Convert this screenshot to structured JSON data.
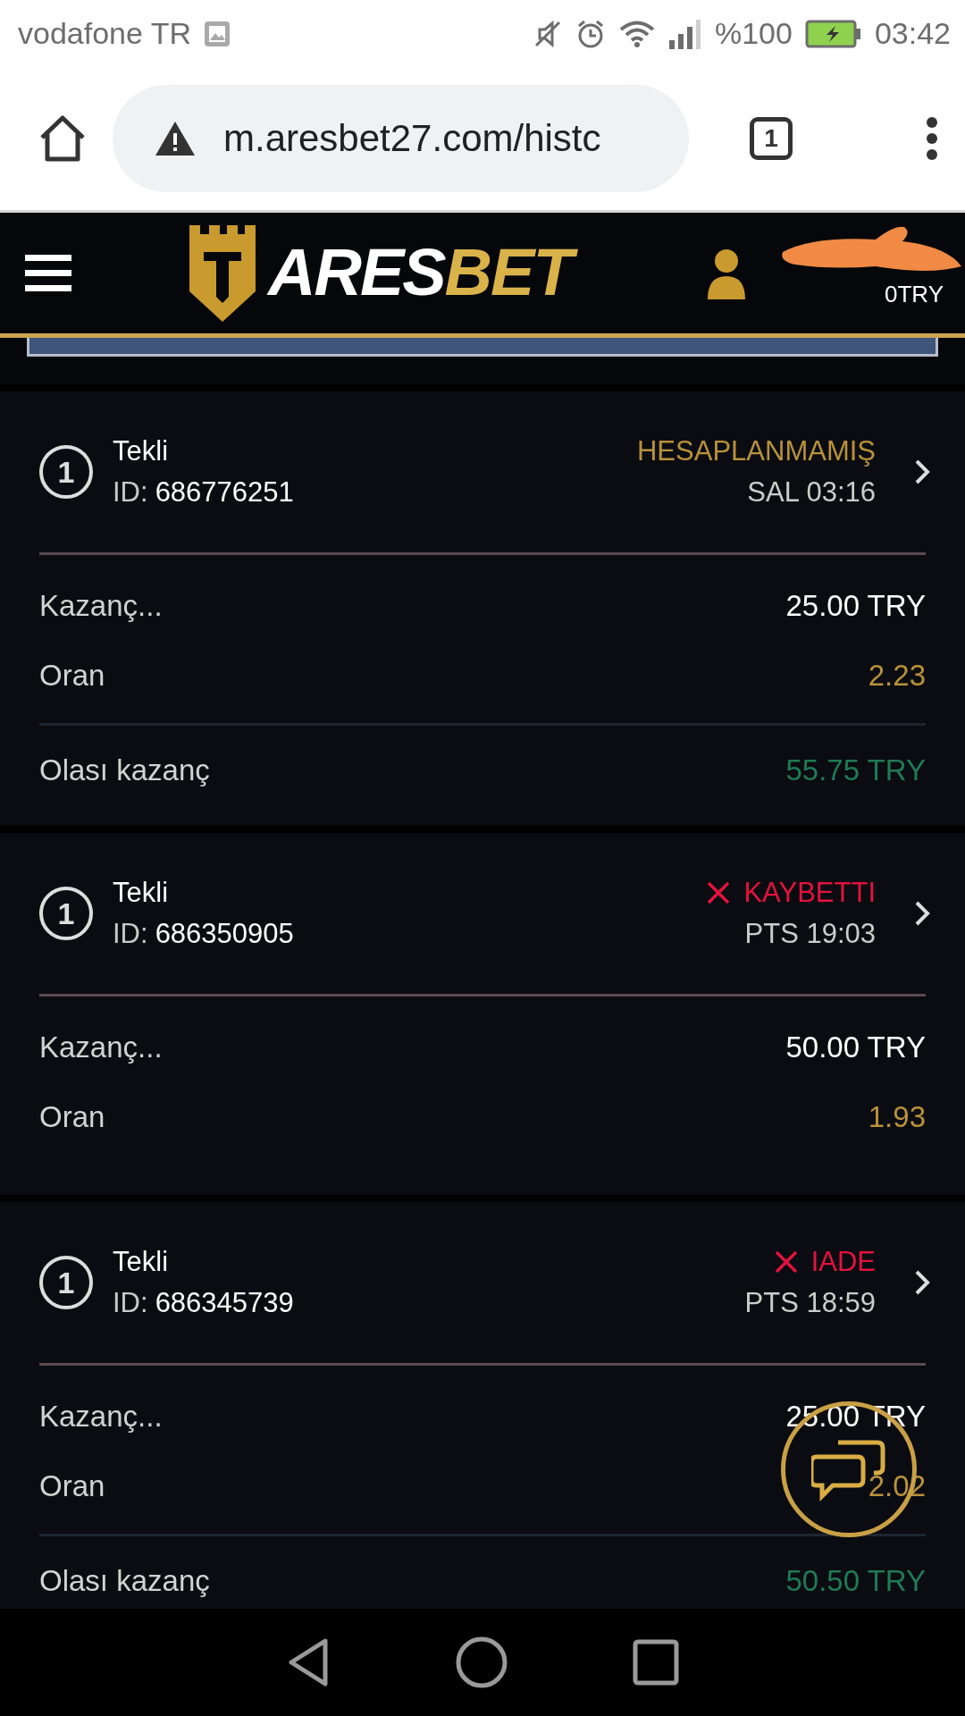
{
  "status_bar": {
    "carrier": "vodafone TR",
    "battery": "%100",
    "time": "03:42"
  },
  "browser": {
    "url": "m.aresbet27.com/histc",
    "tab_count": "1"
  },
  "header": {
    "logo_main": "ARES",
    "logo_accent": "BET",
    "balance": "0TRY"
  },
  "bets": [
    {
      "count": "1",
      "type": "Tekli",
      "id_label": "ID:",
      "id": "686776251",
      "status": "HESAPLANMAMIŞ",
      "kind": "pending",
      "date": "SAL 03:16",
      "rows": [
        {
          "kind": "stake",
          "label": "Kazanç...",
          "value": "25.00 TRY"
        },
        {
          "kind": "odds",
          "label": "Oran",
          "value": "2.23"
        },
        {
          "kind": "potential",
          "label": "Olası kazanç",
          "value": "55.75 TRY"
        }
      ]
    },
    {
      "count": "1",
      "type": "Tekli",
      "id_label": "ID:",
      "id": "686350905",
      "status": "KAYBETTI",
      "kind": "lost",
      "date": "PTS 19:03",
      "rows": [
        {
          "kind": "stake",
          "label": "Kazanç...",
          "value": "50.00 TRY"
        },
        {
          "kind": "odds",
          "label": "Oran",
          "value": "1.93"
        }
      ]
    },
    {
      "count": "1",
      "type": "Tekli",
      "id_label": "ID:",
      "id": "686345739",
      "status": "IADE",
      "kind": "refund",
      "date": "PTS 18:59",
      "rows": [
        {
          "kind": "stake",
          "label": "Kazanç...",
          "value": "25.00 TRY"
        },
        {
          "kind": "odds",
          "label": "Oran",
          "value": "2.02"
        },
        {
          "kind": "potential",
          "label": "Olası kazanç",
          "value": "50.50 TRY"
        }
      ]
    }
  ]
}
